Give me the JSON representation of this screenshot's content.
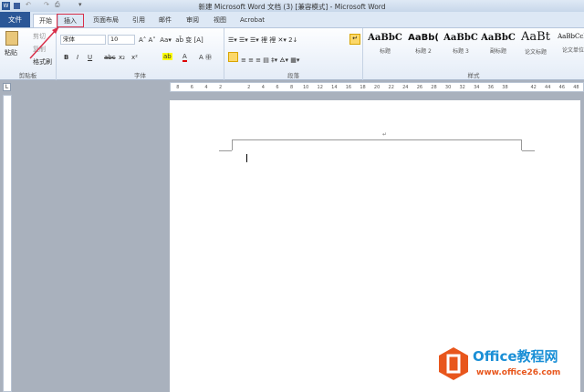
{
  "window": {
    "title": "新建 Microsoft Word 文档 (3) [兼容模式] - Microsoft Word"
  },
  "tabs": {
    "file": "文件",
    "items": [
      "开始",
      "插入",
      "页面布局",
      "引用",
      "邮件",
      "审阅",
      "视图",
      "Acrobat"
    ]
  },
  "clipboard": {
    "paste": "粘贴",
    "cut": "剪切",
    "copy": "复制",
    "format_painter": "格式刷",
    "label": "剪贴板"
  },
  "font": {
    "name": "宋体",
    "size": "10",
    "bold": "B",
    "italic": "I",
    "underline": "U",
    "strike": "abc",
    "sub": "x₂",
    "sup": "x²",
    "label": "字体"
  },
  "paragraph": {
    "label": "段落"
  },
  "styles": {
    "items": [
      {
        "sample": "AaBbC",
        "name": "标题"
      },
      {
        "sample": "AaBb(",
        "name": "标题 2"
      },
      {
        "sample": "AaBbC",
        "name": "标题 3"
      },
      {
        "sample": "AaBbC",
        "name": "副标题"
      },
      {
        "sample": "AaBt",
        "name": "论文标题"
      },
      {
        "sample": "AaBbCcD",
        "name": "论文单位"
      }
    ],
    "label": "样式"
  },
  "ruler": {
    "ticks": [
      "8",
      "6",
      "4",
      "2",
      "",
      "2",
      "4",
      "6",
      "8",
      "10",
      "12",
      "14",
      "16",
      "18",
      "20",
      "22",
      "24",
      "26",
      "28",
      "30",
      "32",
      "34",
      "36",
      "38",
      "",
      "42",
      "44",
      "46",
      "48"
    ]
  },
  "watermark": {
    "brand": "Office教程网",
    "url": "www.office26.com"
  },
  "colors": {
    "file_tab": "#2b5797",
    "insert_highlight": "#d9304a",
    "logo": "#e8561c"
  }
}
